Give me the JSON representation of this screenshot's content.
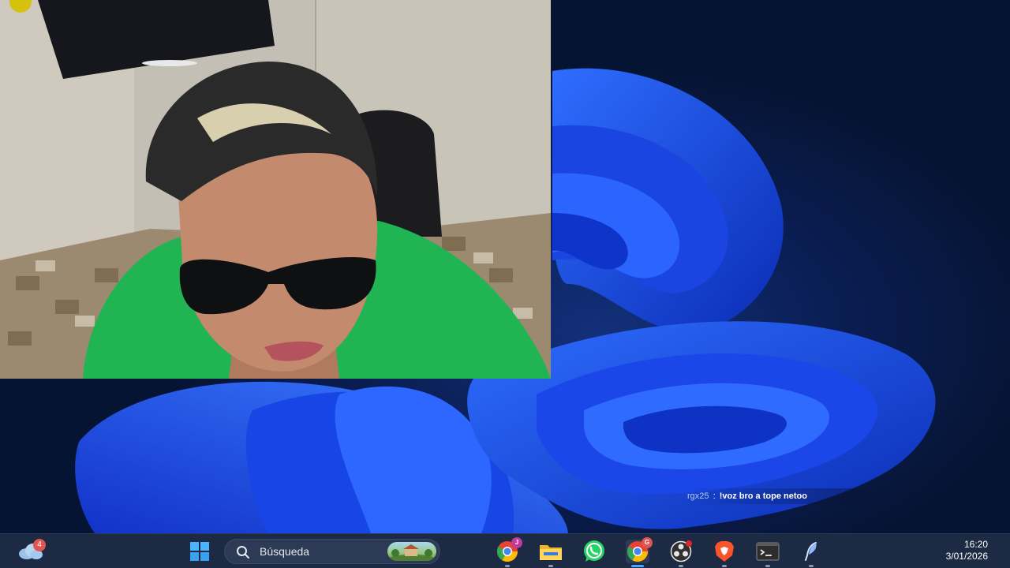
{
  "taskbar": {
    "weather": {
      "icon": "weather-cloud-icon",
      "badge": "4"
    },
    "start": {
      "icon": "windows-start-icon"
    },
    "search": {
      "placeholder": "Búsqueda",
      "icon": "search-icon"
    },
    "apps": [
      {
        "name": "edge-like-browser",
        "icon": "chrome-profile-icon",
        "badge": "J"
      },
      {
        "name": "file-explorer",
        "icon": "folder-icon"
      },
      {
        "name": "whatsapp",
        "icon": "whatsapp-icon"
      },
      {
        "name": "chrome",
        "icon": "chrome-icon",
        "badge": "G",
        "active": true
      },
      {
        "name": "obs",
        "icon": "obs-icon"
      },
      {
        "name": "brave",
        "icon": "brave-icon"
      },
      {
        "name": "terminal",
        "icon": "terminal-icon"
      },
      {
        "name": "feather-app",
        "icon": "feather-icon"
      }
    ],
    "clock": {
      "time": "16:20",
      "date": "3/01/2026"
    }
  },
  "chat": {
    "user": "rgx25",
    "separator": ":",
    "message": "!voz bro a tope netoo"
  },
  "colors": {
    "taskbar_bg": "#1c2a43",
    "accent": "#4ca2ff",
    "badge": "#e0554f",
    "wallpaper_blue": "#1a4bff"
  }
}
